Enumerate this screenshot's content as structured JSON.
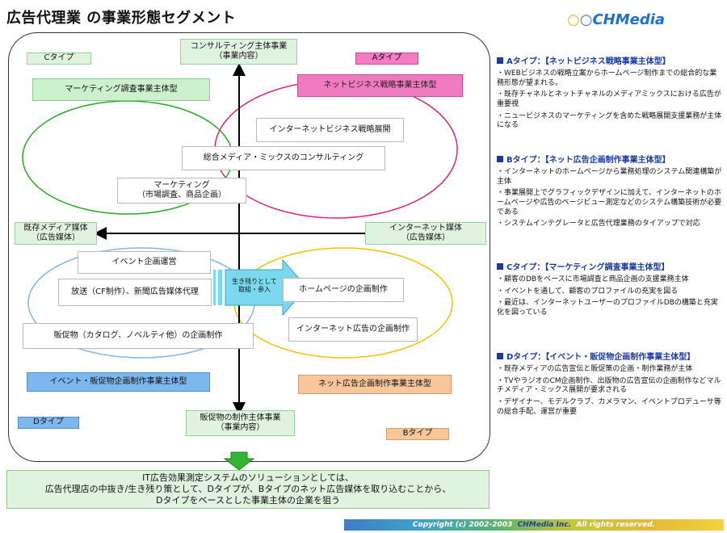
{
  "title": "広告代理業 の事業形態セグメント",
  "logo": {
    "text": "CHMedia"
  },
  "axes": {
    "top": "コンサルティング主体事業\n（事業内容）",
    "bottom": "販促物の制作主体事業\n（事業内容）",
    "left": "既存メディア媒体\n（広告媒体）",
    "right": "インターネット媒体\n（広告媒体）"
  },
  "type_tags": {
    "c": "Cタイプ",
    "a": "Aタイプ",
    "d": "Dタイプ",
    "b": "Bタイプ"
  },
  "type_bars": {
    "c": "マーケティング調査事業主体型",
    "a": "ネットビジネス戦略事業主体型",
    "d": "イベント・販促物企画制作事業主体型",
    "b": "ネット広告企画制作事業主体型"
  },
  "activities": {
    "internet_strategy": "インターネットビジネス戦略展開",
    "consulting": "総合メディア・ミックスのコンサルティング",
    "marketing": "マーケティング\n（市場調査、商品企画）",
    "event": "イベント企画運営",
    "broadcast": "放送（CF制作）、新聞広告媒体代理",
    "promo": "販促物（カタログ、ノベルティ他）の企画制作",
    "homepage": "ホームページの企画制作",
    "net_ad": "インターネット広告の企画制作"
  },
  "arrow_label": "生き残りとして\n取組・参入",
  "bottom_text": "IT広告効果測定システムのソリューションとしては、\n広告代理店の中抜き/生き残り策として、Dタイプが、Bタイプのネット広告媒体を取り込むことから、\nDタイプをベースとした事業主体の企業を狙う",
  "sidebar": {
    "a": {
      "heading": "Aタイプ：【ネットビジネス戦略事業主体型】",
      "items": [
        "・WEBビジネスの戦略立案からホームページ制作までの総合的な業務形態が望まれる。",
        "・既存チャネルとネットチャネルのメディアミックスにおける広告が重要視",
        "・ニュービジネスのマーケティングを含めた戦略展開支援業務が主体になる"
      ]
    },
    "b": {
      "heading": "Bタイプ：【ネット広告企画制作事業主体型】",
      "items": [
        "・インターネットのホームページから業務処理のシステム関連構築が主体",
        "・事業展開上でグラフィックデザインに加えて、インターネットのホームページや広告のページビュー測定などのシステム構築技術が必要である",
        "・システムインテグレータと広告代理業務のタイアップで対応"
      ]
    },
    "c": {
      "heading": "Cタイプ：【マーケティング調査事業主体型】",
      "items": [
        "・顧客のDBをベースに市場調査と商品企画の支援業務主体",
        "・イベントを通して、顧客のプロファイルの充実を図る",
        "・最近は、インターネットユーザーのプロファイルDBの構築と充実化を図っている"
      ]
    },
    "d": {
      "heading": "Dタイプ：【イベント・販促物企画制作事業主体型】",
      "items": [
        "・既存メディアの広告宣伝と販促策の企画・制作業務が主体",
        "・TVやラジオのCM企画制作、出版物の広告宣伝の企画制作などマルチメディア・ミックス展開が要求される",
        "・デザイナー、モデルクラブ、カメラマン、イベントプロデューサ等の総合手配、運営が重要"
      ]
    }
  },
  "footer": {
    "copyright": "Copyright (c) 2002-2003",
    "brand": "CHMedia Inc.",
    "rights": "All rights reserved."
  },
  "colors": {
    "c_ellipse": "#22aa22",
    "a_ellipse": "#e0207a",
    "d_ellipse": "#7fb8e8",
    "b_ellipse": "#f2c200",
    "down_arrow": "#33b533"
  }
}
